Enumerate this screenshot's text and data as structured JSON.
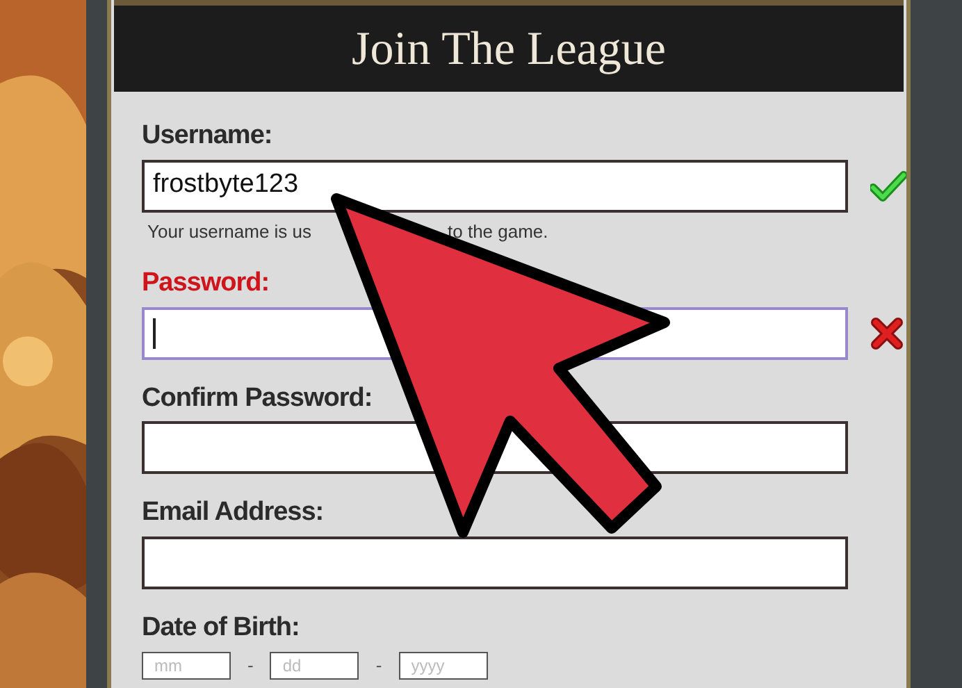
{
  "form": {
    "title": "Join The League",
    "fields": [
      {
        "kind": "text",
        "label": "Username:",
        "value": "frostbyte123",
        "valid": true,
        "error": false,
        "focused": false,
        "hint": [
          "Your username is us",
          "to the game."
        ]
      },
      {
        "kind": "text",
        "label": "Password:",
        "valid": false,
        "error": true,
        "focused": true
      },
      {
        "kind": "text",
        "label": "Confirm Password:",
        "valid": false,
        "error": false,
        "focused": false
      },
      {
        "kind": "text",
        "label": "Email Address:",
        "valid": false,
        "error": false,
        "focused": false
      },
      {
        "kind": "date",
        "label": "Date of Birth:",
        "parts": [
          {
            "placeholder": "mm"
          },
          {
            "placeholder": "dd"
          },
          {
            "placeholder": "yyyy"
          }
        ],
        "separator": "-"
      }
    ]
  }
}
